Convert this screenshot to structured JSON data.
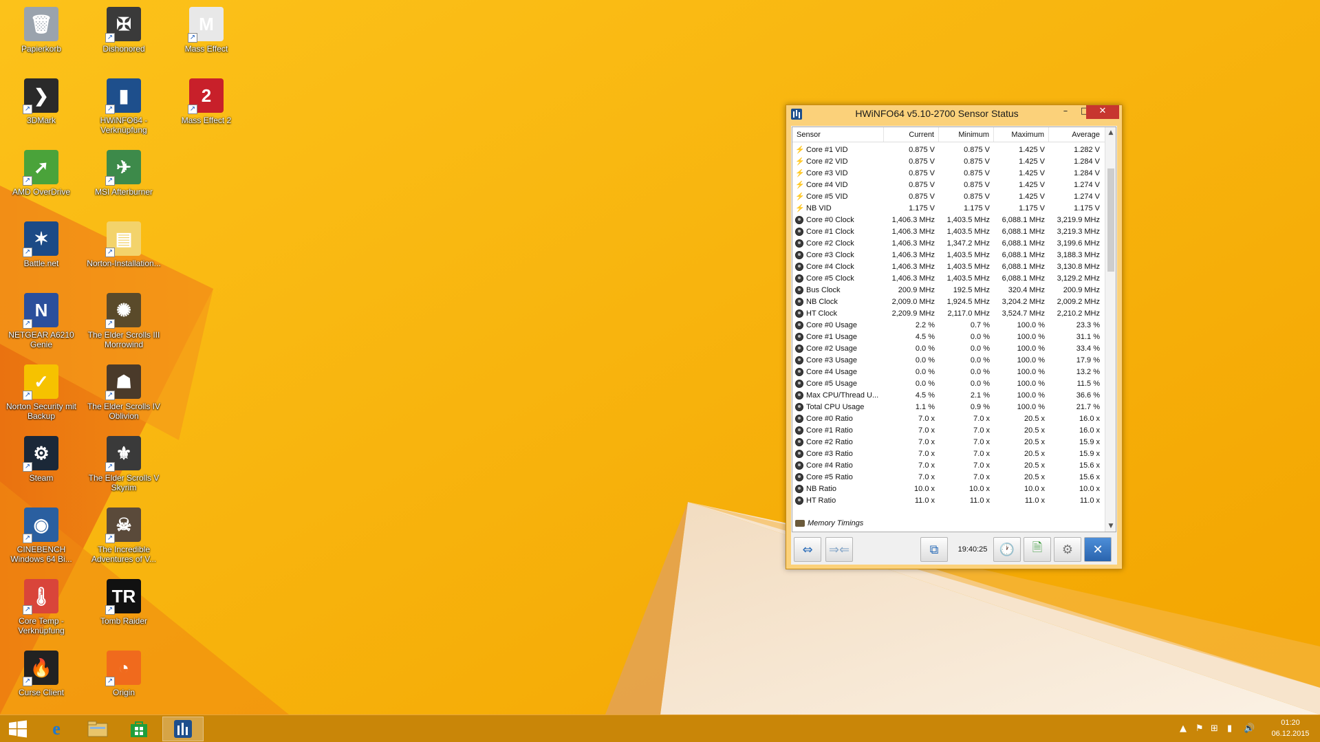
{
  "desktop": {
    "icons": [
      {
        "label": "Papierkorb",
        "icon": "recycle-bin-icon",
        "color": "#9aa3ad",
        "glyph": "🗑"
      },
      {
        "label": "Dishonored",
        "icon": "dishonored-icon",
        "color": "#3a3a3a",
        "glyph": "✠"
      },
      {
        "label": "Mass Effect",
        "icon": "mass-effect-icon",
        "color": "#e8e8e8",
        "glyph": "M"
      },
      {
        "label": "3DMark",
        "icon": "3dmark-icon",
        "color": "#2a2a2a",
        "glyph": "❯"
      },
      {
        "label": "HWiNFO64 - Verknüpfung",
        "icon": "hwinfo-icon",
        "color": "#1e4f8c",
        "glyph": "▮"
      },
      {
        "label": "Mass Effect 2",
        "icon": "mass-effect-2-icon",
        "color": "#c8202a",
        "glyph": "2"
      },
      {
        "label": "AMD OverDrive",
        "icon": "amd-overdrive-icon",
        "color": "#4aa33a",
        "glyph": "➚"
      },
      {
        "label": "MSI Afterburner",
        "icon": "msi-afterburner-icon",
        "color": "#3d8a4a",
        "glyph": "✈"
      },
      {
        "label": "Battle.net",
        "icon": "battlenet-icon",
        "color": "#1c4a86",
        "glyph": "✶"
      },
      {
        "label": "Norton-Installation...",
        "icon": "folder-icon",
        "color": "#f3d36b",
        "glyph": "▤"
      },
      {
        "label": "NETGEAR A6210 Genie",
        "icon": "netgear-icon",
        "color": "#2b4f9c",
        "glyph": "N"
      },
      {
        "label": "The Elder Scrolls III Morrowind",
        "icon": "morrowind-icon",
        "color": "#5a4a2a",
        "glyph": "✺"
      },
      {
        "label": "Norton Security mit Backup",
        "icon": "norton-icon",
        "color": "#f6c200",
        "glyph": "✓"
      },
      {
        "label": "The Elder Scrolls IV Oblivion",
        "icon": "oblivion-icon",
        "color": "#4a3a2a",
        "glyph": "☗"
      },
      {
        "label": "Steam",
        "icon": "steam-icon",
        "color": "#1b2838",
        "glyph": "⚙"
      },
      {
        "label": "The Elder Scrolls V Skyrim",
        "icon": "skyrim-icon",
        "color": "#3a3a3a",
        "glyph": "⚜"
      },
      {
        "label": "CINEBENCH Windows 64 Bi...",
        "icon": "cinebench-icon",
        "color": "#2a5fa0",
        "glyph": "◉"
      },
      {
        "label": "The Incredible Adventures of V...",
        "icon": "van-helsing-icon",
        "color": "#5a4a3a",
        "glyph": "☠"
      },
      {
        "label": "Core Temp - Verknüpfung",
        "icon": "core-temp-icon",
        "color": "#d9453a",
        "glyph": "🌡"
      },
      {
        "label": "Tomb Raider",
        "icon": "tomb-raider-icon",
        "color": "#111111",
        "glyph": "TR"
      },
      {
        "label": "Curse Client",
        "icon": "curse-client-icon",
        "color": "#222222",
        "glyph": "🔥"
      },
      {
        "label": "Origin",
        "icon": "origin-icon",
        "color": "#f06a1d",
        "glyph": "◔"
      }
    ]
  },
  "window": {
    "title": "HWiNFO64 v5.10-2700 Sensor Status",
    "minimize": "–",
    "maximize": "□",
    "close": "✕",
    "columns": [
      "Sensor",
      "Current",
      "Minimum",
      "Maximum",
      "Average"
    ],
    "rows": [
      {
        "type": "volt",
        "name": "Core #1 VID",
        "current": "0.875 V",
        "min": "0.875 V",
        "max": "1.425 V",
        "avg": "1.282 V"
      },
      {
        "type": "volt",
        "name": "Core #2 VID",
        "current": "0.875 V",
        "min": "0.875 V",
        "max": "1.425 V",
        "avg": "1.284 V"
      },
      {
        "type": "volt",
        "name": "Core #3 VID",
        "current": "0.875 V",
        "min": "0.875 V",
        "max": "1.425 V",
        "avg": "1.284 V"
      },
      {
        "type": "volt",
        "name": "Core #4 VID",
        "current": "0.875 V",
        "min": "0.875 V",
        "max": "1.425 V",
        "avg": "1.274 V"
      },
      {
        "type": "volt",
        "name": "Core #5 VID",
        "current": "0.875 V",
        "min": "0.875 V",
        "max": "1.425 V",
        "avg": "1.274 V"
      },
      {
        "type": "volt",
        "name": "NB VID",
        "current": "1.175 V",
        "min": "1.175 V",
        "max": "1.175 V",
        "avg": "1.175 V"
      },
      {
        "type": "dot",
        "name": "Core #0 Clock",
        "current": "1,406.3 MHz",
        "min": "1,403.5 MHz",
        "max": "6,088.1 MHz",
        "avg": "3,219.9 MHz"
      },
      {
        "type": "dot",
        "name": "Core #1 Clock",
        "current": "1,406.3 MHz",
        "min": "1,403.5 MHz",
        "max": "6,088.1 MHz",
        "avg": "3,219.3 MHz"
      },
      {
        "type": "dot",
        "name": "Core #2 Clock",
        "current": "1,406.3 MHz",
        "min": "1,347.2 MHz",
        "max": "6,088.1 MHz",
        "avg": "3,199.6 MHz"
      },
      {
        "type": "dot",
        "name": "Core #3 Clock",
        "current": "1,406.3 MHz",
        "min": "1,403.5 MHz",
        "max": "6,088.1 MHz",
        "avg": "3,188.3 MHz"
      },
      {
        "type": "dot",
        "name": "Core #4 Clock",
        "current": "1,406.3 MHz",
        "min": "1,403.5 MHz",
        "max": "6,088.1 MHz",
        "avg": "3,130.8 MHz"
      },
      {
        "type": "dot",
        "name": "Core #5 Clock",
        "current": "1,406.3 MHz",
        "min": "1,403.5 MHz",
        "max": "6,088.1 MHz",
        "avg": "3,129.2 MHz"
      },
      {
        "type": "dot",
        "name": "Bus Clock",
        "current": "200.9 MHz",
        "min": "192.5 MHz",
        "max": "320.4 MHz",
        "avg": "200.9 MHz"
      },
      {
        "type": "dot",
        "name": "NB Clock",
        "current": "2,009.0 MHz",
        "min": "1,924.5 MHz",
        "max": "3,204.2 MHz",
        "avg": "2,009.2 MHz"
      },
      {
        "type": "dot",
        "name": "HT Clock",
        "current": "2,209.9 MHz",
        "min": "2,117.0 MHz",
        "max": "3,524.7 MHz",
        "avg": "2,210.2 MHz"
      },
      {
        "type": "dot",
        "name": "Core #0 Usage",
        "current": "2.2 %",
        "min": "0.7 %",
        "max": "100.0 %",
        "avg": "23.3 %"
      },
      {
        "type": "dot",
        "name": "Core #1 Usage",
        "current": "4.5 %",
        "min": "0.0 %",
        "max": "100.0 %",
        "avg": "31.1 %"
      },
      {
        "type": "dot",
        "name": "Core #2 Usage",
        "current": "0.0 %",
        "min": "0.0 %",
        "max": "100.0 %",
        "avg": "33.4 %"
      },
      {
        "type": "dot",
        "name": "Core #3 Usage",
        "current": "0.0 %",
        "min": "0.0 %",
        "max": "100.0 %",
        "avg": "17.9 %"
      },
      {
        "type": "dot",
        "name": "Core #4 Usage",
        "current": "0.0 %",
        "min": "0.0 %",
        "max": "100.0 %",
        "avg": "13.2 %"
      },
      {
        "type": "dot",
        "name": "Core #5 Usage",
        "current": "0.0 %",
        "min": "0.0 %",
        "max": "100.0 %",
        "avg": "11.5 %"
      },
      {
        "type": "dot",
        "name": "Max CPU/Thread U...",
        "current": "4.5 %",
        "min": "2.1 %",
        "max": "100.0 %",
        "avg": "36.6 %"
      },
      {
        "type": "dot",
        "name": "Total CPU Usage",
        "current": "1.1 %",
        "min": "0.9 %",
        "max": "100.0 %",
        "avg": "21.7 %"
      },
      {
        "type": "dot",
        "name": "Core #0 Ratio",
        "current": "7.0 x",
        "min": "7.0 x",
        "max": "20.5 x",
        "avg": "16.0 x"
      },
      {
        "type": "dot",
        "name": "Core #1 Ratio",
        "current": "7.0 x",
        "min": "7.0 x",
        "max": "20.5 x",
        "avg": "16.0 x"
      },
      {
        "type": "dot",
        "name": "Core #2 Ratio",
        "current": "7.0 x",
        "min": "7.0 x",
        "max": "20.5 x",
        "avg": "15.9 x"
      },
      {
        "type": "dot",
        "name": "Core #3 Ratio",
        "current": "7.0 x",
        "min": "7.0 x",
        "max": "20.5 x",
        "avg": "15.9 x"
      },
      {
        "type": "dot",
        "name": "Core #4 Ratio",
        "current": "7.0 x",
        "min": "7.0 x",
        "max": "20.5 x",
        "avg": "15.6 x"
      },
      {
        "type": "dot",
        "name": "Core #5 Ratio",
        "current": "7.0 x",
        "min": "7.0 x",
        "max": "20.5 x",
        "avg": "15.6 x"
      },
      {
        "type": "dot",
        "name": "NB Ratio",
        "current": "10.0 x",
        "min": "10.0 x",
        "max": "10.0 x",
        "avg": "10.0 x"
      },
      {
        "type": "dot",
        "name": "HT Ratio",
        "current": "11.0 x",
        "min": "11.0 x",
        "max": "11.0 x",
        "avg": "11.0 x"
      }
    ],
    "group": "Memory Timings",
    "timer": "19:40:25"
  },
  "taskbar": {
    "clock_time": "01:20",
    "clock_date": "06.12.2015"
  },
  "colors": {
    "wallpaper": "#f7b20c",
    "taskbar": "#c98608",
    "close_button": "#c7362f"
  }
}
